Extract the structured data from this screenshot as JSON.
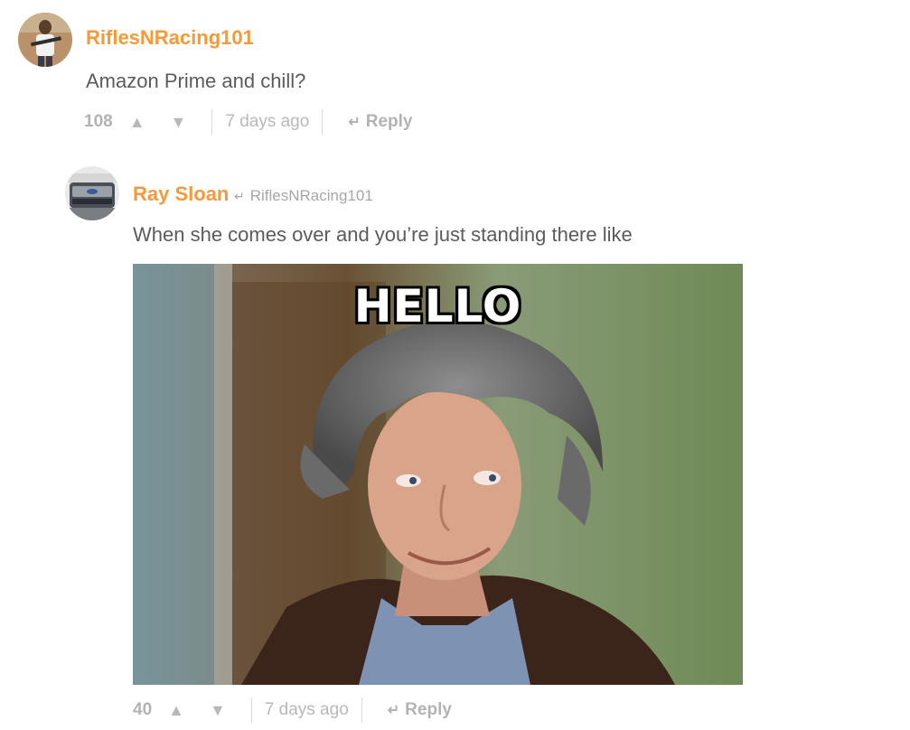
{
  "comments": [
    {
      "username": "RiflesNRacing101",
      "text": "Amazon Prime and chill?",
      "votes": "108",
      "time": "7 days ago",
      "reply_label": "Reply"
    },
    {
      "username": "Ray Sloan",
      "reply_to": "RiflesNRacing101",
      "text": "When she comes over and you’re just standing there like",
      "meme_caption": "HELLO",
      "votes": "40",
      "time": "7 days ago",
      "reply_label": "Reply"
    }
  ],
  "icons": {
    "upvote": "▲",
    "downvote": "▼",
    "reply_arrow": "↵"
  },
  "colors": {
    "username": "#f59a3b",
    "meta": "#b3b3b3"
  }
}
